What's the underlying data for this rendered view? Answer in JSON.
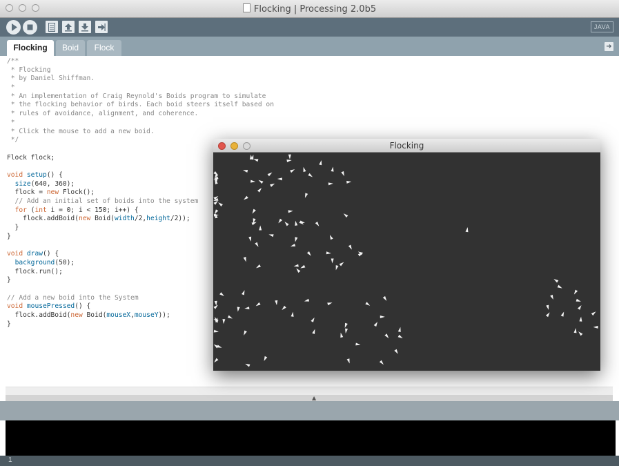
{
  "window": {
    "title": "Flocking | Processing 2.0b5"
  },
  "toolbar": {
    "buttons": [
      "run-icon",
      "stop-icon",
      "new-icon",
      "open-icon",
      "save-icon",
      "export-icon"
    ],
    "mode": "JAVA"
  },
  "tabs": [
    {
      "label": "Flocking",
      "active": true
    },
    {
      "label": "Boid",
      "active": false
    },
    {
      "label": "Flock",
      "active": false
    }
  ],
  "code": [
    "/**",
    " * Flocking",
    " * by Daniel Shiffman.",
    " *",
    " * An implementation of Craig Reynold's Boids program to simulate",
    " * the flocking behavior of birds. Each boid steers itself based on",
    " * rules of avoidance, alignment, and coherence.",
    " *",
    " * Click the mouse to add a new boid.",
    " */",
    "",
    "Flock flock;",
    "",
    "void setup() {",
    "  size(640, 360);",
    "  flock = new Flock();",
    "  // Add an initial set of boids into the system",
    "  for (int i = 0; i < 150; i++) {",
    "    flock.addBoid(new Boid(width/2,height/2));",
    "  }",
    "}",
    "",
    "void draw() {",
    "  background(50);",
    "  flock.run();",
    "}",
    "",
    "// Add a new boid into the System",
    "void mousePressed() {",
    "  flock.addBoid(new Boid(mouseX,mouseY));",
    "}"
  ],
  "console": {
    "line_number": "1"
  },
  "sketch": {
    "title": "Flocking",
    "background": "#323232"
  },
  "colors": {
    "toolbar": "#5d6f7c",
    "tabbar": "#8fa2ad",
    "comment": "#888888",
    "keyword": "#cc6633",
    "function": "#006699"
  }
}
